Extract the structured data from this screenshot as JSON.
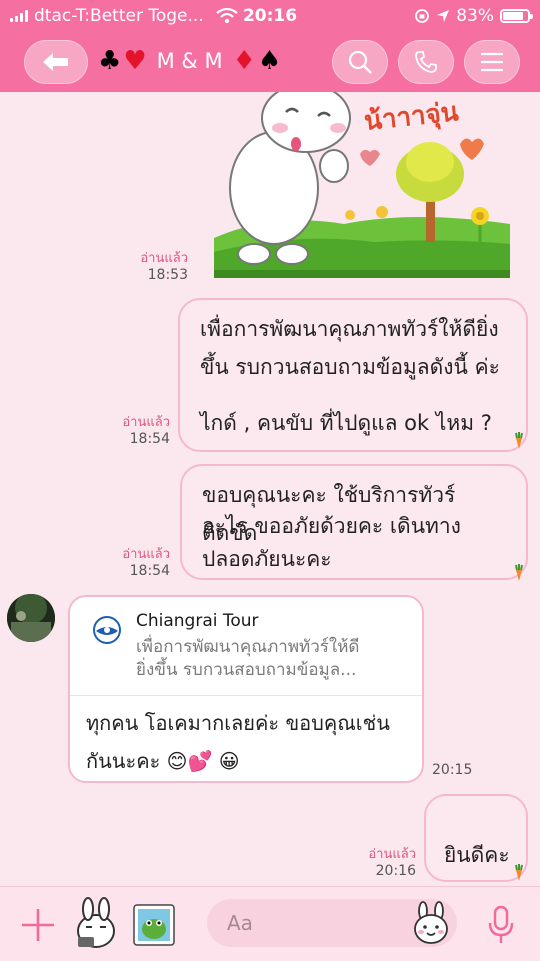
{
  "statusbar": {
    "carrier": "dtac-T:Better Toge...",
    "time": "20:16",
    "battery": "83%",
    "battery_level": 0.83
  },
  "header": {
    "title_left_suits": [
      "♣",
      "♥"
    ],
    "title_text": "M & M",
    "title_right_suits": [
      "♦",
      "♠"
    ],
    "back_icon": "back-arrow-icon",
    "search_icon": "search-icon",
    "call_icon": "phone-icon",
    "menu_icon": "menu-icon"
  },
  "messages": [
    {
      "id": "sticker",
      "read_label": "อ่านแล้ว",
      "time": "18:53",
      "sticker_text": "น้าาาจุ่น"
    },
    {
      "id": "msg1",
      "lines": [
        "เพื่อการพัฒนาคุณภาพทัวร์ให้ดียิ่ง",
        "ขึ้น รบกวนสอบถามข้อมูลดังนี้ ค่ะ",
        "",
        "ไกด์ , คนขับ ที่ไปดูแล ok ไหม ?"
      ],
      "read_label": "อ่านแล้ว",
      "time": "18:54"
    },
    {
      "id": "msg2",
      "lines": [
        "ขอบคุณนะคะ ใช้บริการทัวร์ ติดขัด",
        "อะไร ขออภัยด้วยคะ เดินทาง",
        "ปลอดภัยนะคะ"
      ],
      "read_label": "อ่านแล้ว",
      "time": "18:54"
    },
    {
      "id": "reply",
      "quote_name": "Chiangrai Tour",
      "quote_lines": [
        "เพื่อการพัฒนาคุณภาพทัวร์ให้ดี",
        "ยิ่งขึ้น รบกวนสอบถามข้อมูล..."
      ],
      "reply_lines": [
        "ทุกคน โอเคมากเลยค่ะ ขอบคุณเช่น",
        "กันนะคะ 😊💕 😀"
      ],
      "time": "20:15"
    },
    {
      "id": "msg3",
      "lines": [
        "ยินดีคะ"
      ],
      "read_label": "อ่านแล้ว",
      "time": "20:16"
    }
  ],
  "composer": {
    "placeholder": "Aa",
    "add_icon": "plus-icon",
    "sticker_icon": "sticker-icon",
    "photo_icon": "photo-icon",
    "emoji_icon": "emoji-face-icon",
    "mic_icon": "microphone-icon"
  },
  "colors": {
    "header_pink": "#f56fa0",
    "bubble_border": "#f5b9cf",
    "chat_bg": "#fbe8ef",
    "read_label": "#e0567f"
  }
}
